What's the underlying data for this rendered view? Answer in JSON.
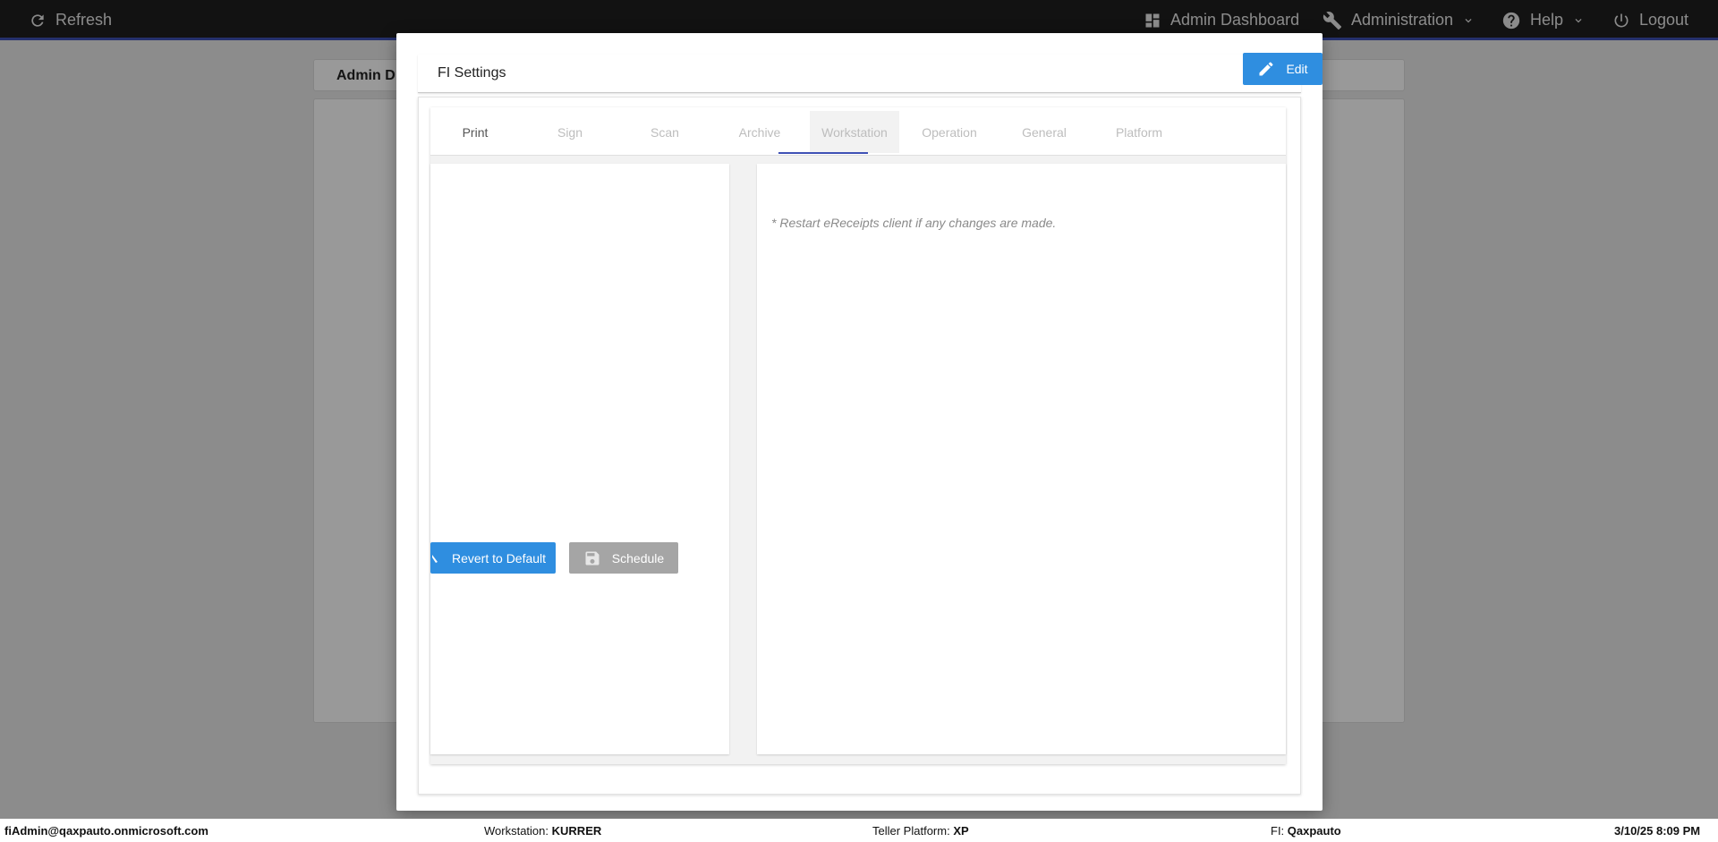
{
  "topbar": {
    "refresh_label": "Refresh",
    "admin_dashboard_label": "Admin Dashboard",
    "administration_label": "Administration",
    "help_label": "Help",
    "logout_label": "Logout"
  },
  "background": {
    "card_title": "Admin D"
  },
  "modal": {
    "title": "FI Settings",
    "edit_label": "Edit",
    "tabs": [
      {
        "label": "Print"
      },
      {
        "label": "Sign"
      },
      {
        "label": "Scan"
      },
      {
        "label": "Archive"
      },
      {
        "label": "Workstation"
      },
      {
        "label": "Operation"
      },
      {
        "label": "General"
      },
      {
        "label": "Platform"
      }
    ],
    "active_tab": "Workstation",
    "restart_note": "* Restart eReceipts client if any changes are made.",
    "revert_label": "Revert to Default",
    "schedule_label": "Schedule"
  },
  "statusbar": {
    "user": "fiAdmin@qaxpauto.onmicrosoft.com",
    "workstation_label": "Workstation:",
    "workstation_value": "KURRER",
    "platform_label": "Teller Platform:",
    "platform_value": "XP",
    "fi_label": "FI:",
    "fi_value": "Qaxpauto",
    "datetime": "3/10/25 8:09 PM"
  },
  "colors": {
    "accent": "#2f8ee0",
    "tab_indicator": "#3f51b5",
    "topbar_bg": "#1f1f1f"
  }
}
